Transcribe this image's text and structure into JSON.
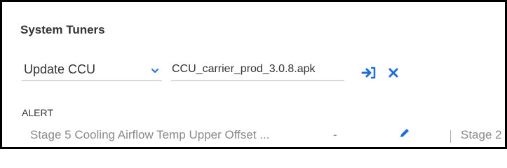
{
  "header": {
    "title": "System Tuners"
  },
  "update": {
    "selected": "Update CCU",
    "file_name": "CCU_carrier_prod_3.0.8.apk"
  },
  "alert": {
    "label": "ALERT",
    "row": {
      "name": "Stage 5 Cooling Airflow Temp Upper Offset ...",
      "value": "-",
      "next_column_text": "Stage 2"
    }
  },
  "icons": {
    "chevron": "chevron-down-icon",
    "submit": "sign-in-icon",
    "clear": "close-icon",
    "edit": "pencil-icon"
  },
  "colors": {
    "accent": "#1e6fd9",
    "border": "#000000",
    "muted_text": "#8a8a8a"
  }
}
